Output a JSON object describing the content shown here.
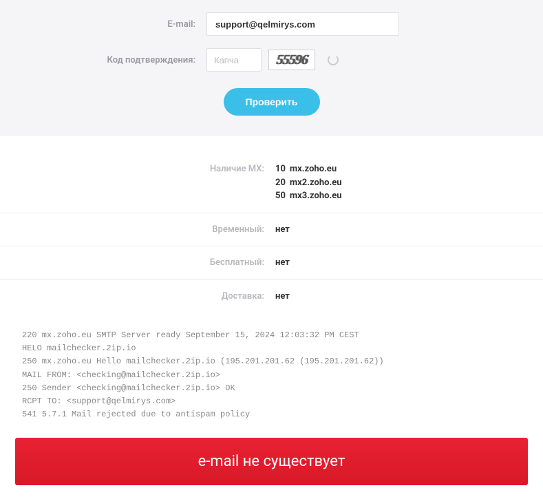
{
  "form": {
    "email_label": "E-mail:",
    "email_value": "support@qelmirys.com",
    "captcha_label": "Код подтверждения:",
    "captcha_placeholder": "Капча",
    "captcha_text": "55596",
    "submit_label": "Проверить"
  },
  "results": {
    "mx_label": "Наличие MX:",
    "mx_records": [
      {
        "priority": "10",
        "host": "mx.zoho.eu"
      },
      {
        "priority": "20",
        "host": "mx2.zoho.eu"
      },
      {
        "priority": "50",
        "host": "mx3.zoho.eu"
      }
    ],
    "temporary_label": "Временный:",
    "temporary_value": "нет",
    "free_label": "Бесплатный:",
    "free_value": "нет",
    "delivery_label": "Доставка:",
    "delivery_value": "нет"
  },
  "smtp_log": "220 mx.zoho.eu SMTP Server ready September 15, 2024 12:03:32 PM CEST\nHELO mailchecker.2ip.io\n250 mx.zoho.eu Hello mailchecker.2ip.io (195.201.201.62 (195.201.201.62))\nMAIL FROM: <checking@mailchecker.2ip.io>\n250 Sender <checking@mailchecker.2ip.io> OK\nRCPT TO: <support@qelmirys.com>\n541 5.7.1 Mail rejected due to antispam policy",
  "status_text": "e-mail не существует"
}
